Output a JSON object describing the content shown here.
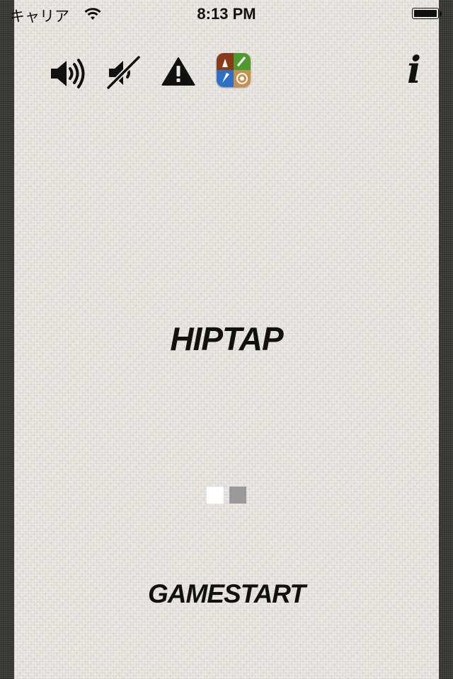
{
  "status_bar": {
    "carrier": "キャリア",
    "time": "8:13 PM",
    "wifi_icon": "wifi-icon",
    "battery_icon": "battery-icon"
  },
  "toolbar": {
    "icons": [
      "sound-on-icon",
      "sound-off-icon",
      "warning-icon",
      "game-center-icon",
      "info-icon"
    ],
    "info_glyph": "i"
  },
  "main": {
    "title": "HIPTAP",
    "page_indicator": {
      "pages": 2,
      "current": 1
    },
    "start_label": "GAMESTART"
  },
  "colors": {
    "background": "#ebe7e2",
    "frame": "#3d3c37",
    "text": "#111111",
    "dot_active": "#ffffff",
    "dot_inactive": "#9a9a9a"
  }
}
